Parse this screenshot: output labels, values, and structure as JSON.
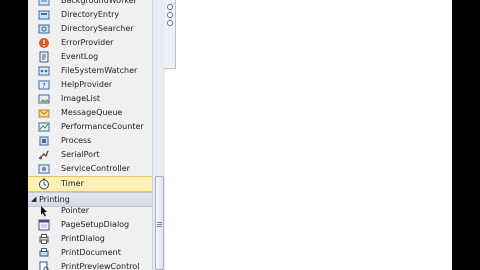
{
  "toolbox": {
    "items_top": [
      {
        "label": "BackgroundWorker",
        "icon": "background-worker-icon"
      },
      {
        "label": "DirectoryEntry",
        "icon": "directory-entry-icon"
      },
      {
        "label": "DirectorySearcher",
        "icon": "directory-searcher-icon"
      },
      {
        "label": "ErrorProvider",
        "icon": "error-provider-icon"
      },
      {
        "label": "EventLog",
        "icon": "event-log-icon"
      },
      {
        "label": "FileSystemWatcher",
        "icon": "file-system-watcher-icon"
      },
      {
        "label": "HelpProvider",
        "icon": "help-provider-icon"
      },
      {
        "label": "ImageList",
        "icon": "image-list-icon"
      },
      {
        "label": "MessageQueue",
        "icon": "message-queue-icon"
      },
      {
        "label": "PerformanceCounter",
        "icon": "performance-counter-icon"
      },
      {
        "label": "Process",
        "icon": "process-icon"
      },
      {
        "label": "SerialPort",
        "icon": "serial-port-icon"
      },
      {
        "label": "ServiceController",
        "icon": "service-controller-icon"
      },
      {
        "label": "Timer",
        "icon": "timer-icon",
        "selected": true
      }
    ],
    "printing_group": {
      "label": "Printing",
      "expand_glyph": "◢",
      "items": [
        {
          "label": "Pointer",
          "icon": "pointer-icon"
        },
        {
          "label": "PageSetupDialog",
          "icon": "page-setup-dialog-icon"
        },
        {
          "label": "PrintDialog",
          "icon": "print-dialog-icon"
        },
        {
          "label": "PrintDocument",
          "icon": "print-document-icon"
        },
        {
          "label": "PrintPreviewControl",
          "icon": "print-preview-control-icon"
        }
      ]
    }
  }
}
